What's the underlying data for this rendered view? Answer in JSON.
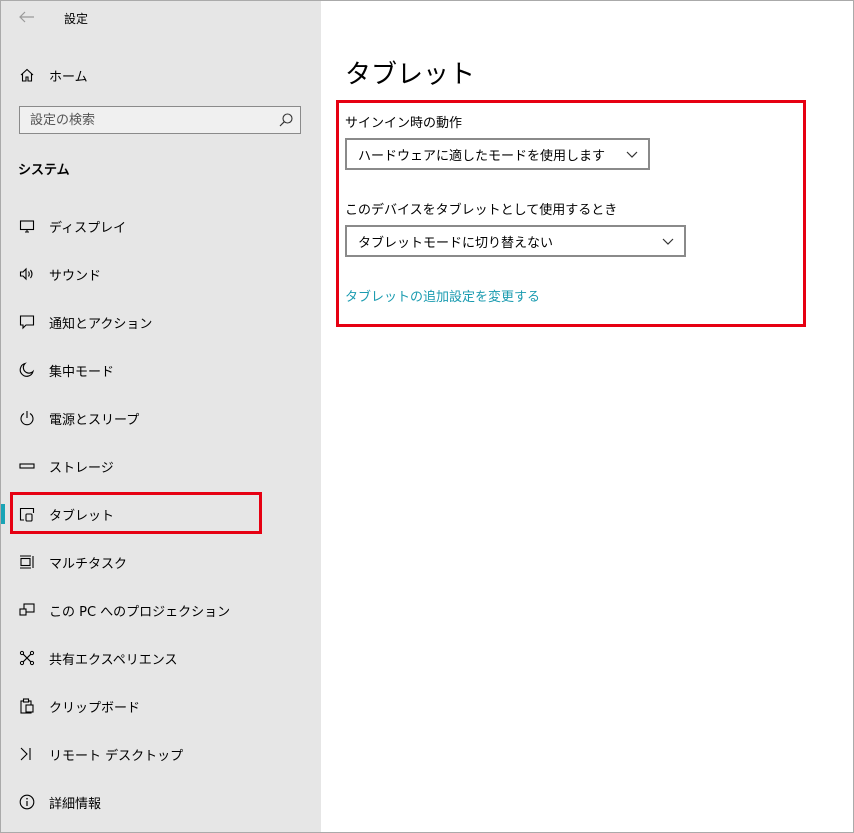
{
  "window": {
    "title": "設定"
  },
  "sidebar": {
    "home_label": "ホーム",
    "search_placeholder": "設定の検索",
    "section_title": "システム",
    "items": [
      {
        "label": "ディスプレイ",
        "icon": "display-icon"
      },
      {
        "label": "サウンド",
        "icon": "speaker-icon"
      },
      {
        "label": "通知とアクション",
        "icon": "notification-icon"
      },
      {
        "label": "集中モード",
        "icon": "moon-icon"
      },
      {
        "label": "電源とスリープ",
        "icon": "power-icon"
      },
      {
        "label": "ストレージ",
        "icon": "storage-icon"
      },
      {
        "label": "タブレット",
        "icon": "tablet-icon",
        "selected": true
      },
      {
        "label": "マルチタスク",
        "icon": "multitask-icon"
      },
      {
        "label": "この PC へのプロジェクション",
        "icon": "projection-icon"
      },
      {
        "label": "共有エクスペリエンス",
        "icon": "shared-experience-icon"
      },
      {
        "label": "クリップボード",
        "icon": "clipboard-icon"
      },
      {
        "label": "リモート デスクトップ",
        "icon": "remote-desktop-icon"
      },
      {
        "label": "詳細情報",
        "icon": "info-icon"
      }
    ]
  },
  "main": {
    "title": "タブレット",
    "signin": {
      "label": "サインイン時の動作",
      "value": "ハードウェアに適したモードを使用します"
    },
    "tablet_use": {
      "label": "このデバイスをタブレットとして使用するとき",
      "value": "タブレットモードに切り替えない"
    },
    "link_label": "タブレットの追加設定を変更する"
  },
  "colors": {
    "accent": "#1aa4b6",
    "link": "#1a9bb0",
    "highlight": "#e60012",
    "sidebar_bg": "#e6e6e6"
  }
}
